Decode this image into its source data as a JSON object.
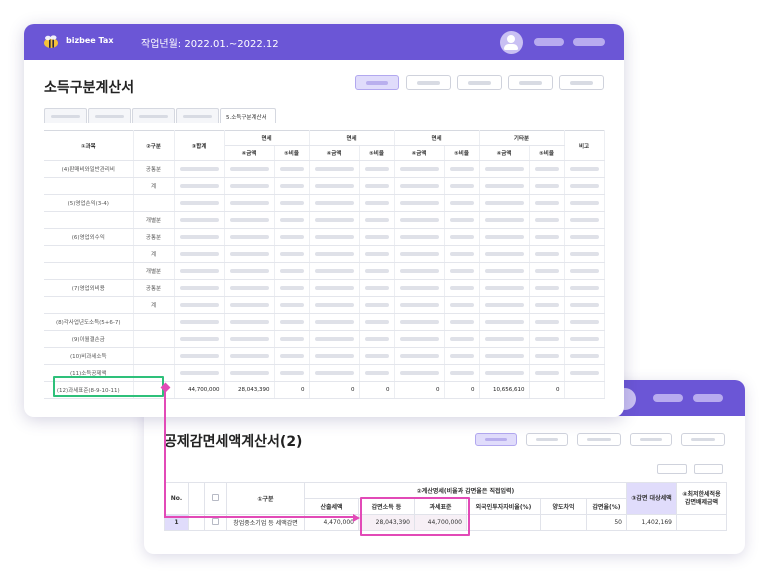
{
  "window1": {
    "brand": "bizbee Tax",
    "period": "작업년월: 2022.01.~2022.12",
    "title": "소득구분계산서",
    "active_tab": "5.소득구분계산서",
    "headers": {
      "subject": "①과목",
      "category": "②구분",
      "total": "③합계",
      "group1": "면세",
      "group2": "면세",
      "group3": "면세",
      "group4": "기타분",
      "amount": "④금액",
      "ratio": "⑤비율",
      "note": "비고"
    },
    "rows": [
      {
        "subject": "(4)판매비와일반관리비",
        "category": "공통분"
      },
      {
        "subject": "",
        "category": "계"
      },
      {
        "subject": "(5)영업손익(3-4)",
        "category": ""
      },
      {
        "subject": "",
        "category": "개별분"
      },
      {
        "subject": "(6)영업외수익",
        "category": "공통분"
      },
      {
        "subject": "",
        "category": "계"
      },
      {
        "subject": "",
        "category": "개별분"
      },
      {
        "subject": "(7)영업외비용",
        "category": "공통분"
      },
      {
        "subject": "",
        "category": "계"
      },
      {
        "subject": "(8)각사업년도소득(5+6-7)",
        "category": ""
      },
      {
        "subject": "(9)이월결손금",
        "category": ""
      },
      {
        "subject": "(10)비과세소득",
        "category": ""
      },
      {
        "subject": "(11)소득공제액",
        "category": ""
      }
    ],
    "total_row": {
      "subject": "(12)과세표준(8-9-10-11)",
      "total": "44,700,000",
      "amt1": "28,043,390",
      "ratio1": "0",
      "amt2": "0",
      "ratio2": "0",
      "amt3": "0",
      "ratio3": "0",
      "amt4": "10,656,610",
      "ratio4": "0"
    }
  },
  "window2": {
    "title": "공제감면세액계산서(2)",
    "headers": {
      "no": "No.",
      "category": "①구분",
      "calc_group": "②계산명세(비율과 감면율은 직접입력)",
      "calc_amount": "산출세액",
      "reduced_income": "감면소득 등",
      "tax_base": "과세표준",
      "foreign_ratio": "외국인투자자비율(%)",
      "transfer_diff": "양도차익",
      "reduction_rate": "감면율(%)",
      "reduction_target": "③감면 대상세액",
      "min_tax": "④최저한세적용 감면배제금액"
    },
    "row": {
      "no": "1",
      "category": "창업중소기업 등 세액감면",
      "calc_amount": "4,470,000",
      "reduced_income": "28,043,390",
      "tax_base": "44,700,000",
      "foreign_ratio": "",
      "transfer_diff": "",
      "reduction_rate": "50",
      "reduction_target": "1,402,169"
    }
  },
  "colors": {
    "accent": "#6b56d6",
    "highlight_green": "#2ec07a",
    "highlight_pink": "#e24ab7",
    "active_fill": "#e0dcfb"
  }
}
